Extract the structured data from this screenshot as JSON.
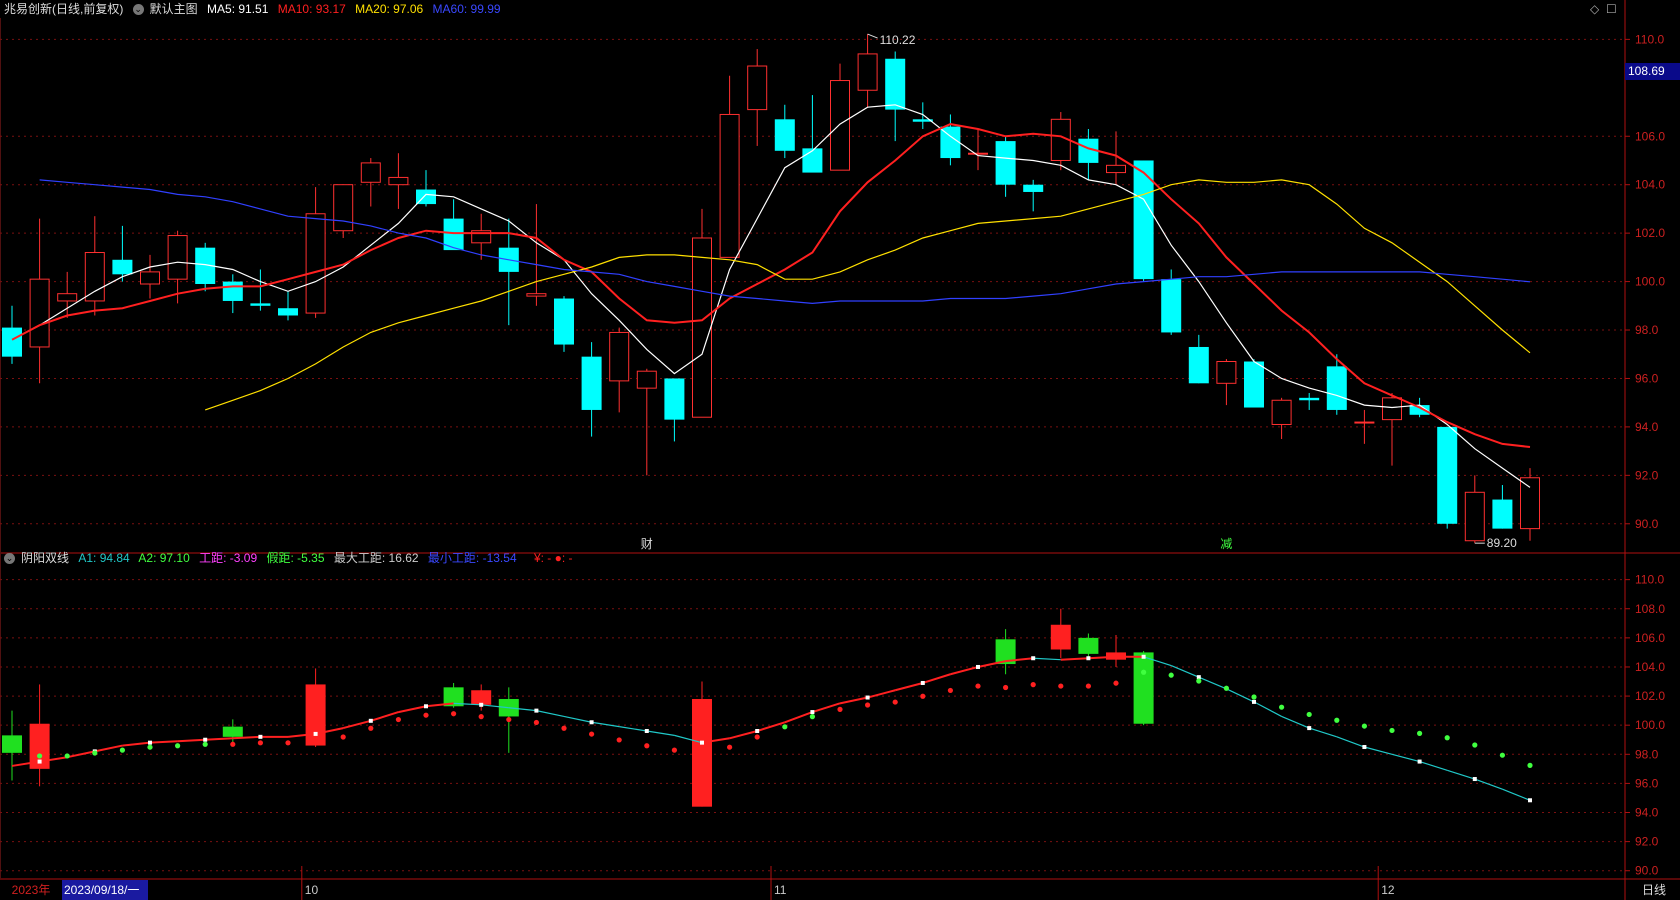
{
  "main_header": {
    "stock": "兆易创新(日线,前复权)",
    "template": "默认主图",
    "items": [
      {
        "label": "MA5: 91.51",
        "color": "#ffffff"
      },
      {
        "label": "MA10: 93.17",
        "color": "#ff2020"
      },
      {
        "label": "MA20: 97.06",
        "color": "#ffe000"
      },
      {
        "label": "MA60: 99.99",
        "color": "#3040ff"
      }
    ]
  },
  "sub_header": {
    "name": "阴阳双线",
    "items": [
      {
        "label": "A1: 94.84",
        "color": "#20c8c8"
      },
      {
        "label": "A2: 97.10",
        "color": "#40ff40"
      },
      {
        "label": "工距: -3.09",
        "color": "#ff40ff"
      },
      {
        "label": "假距: -5.35",
        "color": "#40ff40"
      },
      {
        "label": "最大工距: 16.62",
        "color": "#cccccc"
      },
      {
        "label": "最小工距: -13.54",
        "color": "#3040ff"
      },
      {
        "label": "¥: -  ●: -",
        "color": "#ff2020"
      }
    ]
  },
  "current_price": "108.69",
  "footer": {
    "year": "2023年",
    "date": "2023/09/18/一",
    "period": "日线",
    "month_labels": [
      "10",
      "11",
      "12"
    ]
  },
  "marks": {
    "cai": "财",
    "jian": "减"
  },
  "chart_data": [
    {
      "type": "candlestick",
      "title": "兆易创新(日线,前复权)",
      "ylim": [
        89,
        110.8
      ],
      "y_ticks": [
        "110.0",
        "108.69",
        "106.0",
        "104.0",
        "102.0",
        "100.0",
        "98.0",
        "96.0",
        "94.0",
        "92.0",
        "90.0"
      ],
      "annotations": [
        {
          "text": "110.22",
          "index": 31
        },
        {
          "text": "89.20",
          "index": 53
        }
      ],
      "month_starts": {
        "10": 11,
        "11": 28,
        "12": 50
      },
      "candles": [
        {
          "o": 98.1,
          "h": 99.0,
          "l": 96.6,
          "c": 96.9
        },
        {
          "o": 97.3,
          "h": 102.6,
          "l": 95.8,
          "c": 100.1
        },
        {
          "o": 99.2,
          "h": 100.4,
          "l": 98.5,
          "c": 99.5
        },
        {
          "o": 99.2,
          "h": 102.7,
          "l": 98.6,
          "c": 101.2
        },
        {
          "o": 100.9,
          "h": 102.3,
          "l": 100.0,
          "c": 100.3
        },
        {
          "o": 99.9,
          "h": 101.1,
          "l": 99.3,
          "c": 100.4
        },
        {
          "o": 100.1,
          "h": 102.1,
          "l": 99.1,
          "c": 101.9
        },
        {
          "o": 101.4,
          "h": 101.6,
          "l": 99.6,
          "c": 99.9
        },
        {
          "o": 100.0,
          "h": 100.3,
          "l": 98.7,
          "c": 99.2
        },
        {
          "o": 99.1,
          "h": 100.5,
          "l": 98.8,
          "c": 99.0
        },
        {
          "o": 98.9,
          "h": 99.6,
          "l": 98.4,
          "c": 98.6
        },
        {
          "o": 98.7,
          "h": 103.9,
          "l": 98.5,
          "c": 102.8
        },
        {
          "o": 102.1,
          "h": 104.0,
          "l": 101.8,
          "c": 104.0
        },
        {
          "o": 104.1,
          "h": 105.1,
          "l": 103.1,
          "c": 104.9
        },
        {
          "o": 104.0,
          "h": 105.3,
          "l": 103.0,
          "c": 104.3
        },
        {
          "o": 103.8,
          "h": 104.6,
          "l": 103.1,
          "c": 103.2
        },
        {
          "o": 102.6,
          "h": 103.4,
          "l": 101.4,
          "c": 101.3
        },
        {
          "o": 101.6,
          "h": 102.8,
          "l": 100.9,
          "c": 102.1
        },
        {
          "o": 101.4,
          "h": 102.6,
          "l": 98.2,
          "c": 100.4
        },
        {
          "o": 99.4,
          "h": 103.2,
          "l": 99.0,
          "c": 99.5
        },
        {
          "o": 99.3,
          "h": 99.4,
          "l": 97.1,
          "c": 97.4
        },
        {
          "o": 96.9,
          "h": 97.5,
          "l": 93.6,
          "c": 94.7
        },
        {
          "o": 95.9,
          "h": 98.1,
          "l": 94.6,
          "c": 97.9
        },
        {
          "o": 95.6,
          "h": 96.4,
          "l": 92.0,
          "c": 96.3
        },
        {
          "o": 96.0,
          "h": 96.0,
          "l": 93.4,
          "c": 94.3
        },
        {
          "o": 94.4,
          "h": 103.0,
          "l": 94.4,
          "c": 101.8
        },
        {
          "o": 101.0,
          "h": 108.5,
          "l": 101.0,
          "c": 106.9
        },
        {
          "o": 107.1,
          "h": 109.6,
          "l": 105.6,
          "c": 108.9
        },
        {
          "o": 106.7,
          "h": 107.3,
          "l": 105.1,
          "c": 105.4
        },
        {
          "o": 105.5,
          "h": 107.7,
          "l": 104.6,
          "c": 104.5
        },
        {
          "o": 104.6,
          "h": 109.0,
          "l": 104.6,
          "c": 108.3
        },
        {
          "o": 107.9,
          "h": 110.22,
          "l": 107.2,
          "c": 109.4
        },
        {
          "o": 109.2,
          "h": 109.5,
          "l": 105.8,
          "c": 107.1
        },
        {
          "o": 106.7,
          "h": 107.4,
          "l": 106.3,
          "c": 106.6
        },
        {
          "o": 106.4,
          "h": 106.9,
          "l": 104.8,
          "c": 105.1
        },
        {
          "o": 105.3,
          "h": 106.3,
          "l": 104.6,
          "c": 105.3
        },
        {
          "o": 105.8,
          "h": 106.0,
          "l": 103.5,
          "c": 104.0
        },
        {
          "o": 104.0,
          "h": 104.2,
          "l": 102.9,
          "c": 103.7
        },
        {
          "o": 105.0,
          "h": 107.0,
          "l": 104.6,
          "c": 106.7
        },
        {
          "o": 105.9,
          "h": 106.3,
          "l": 104.2,
          "c": 104.9
        },
        {
          "o": 104.5,
          "h": 106.2,
          "l": 104.0,
          "c": 104.8
        },
        {
          "o": 105.0,
          "h": 105.0,
          "l": 100.0,
          "c": 100.1
        },
        {
          "o": 100.1,
          "h": 100.5,
          "l": 97.8,
          "c": 97.9
        },
        {
          "o": 97.3,
          "h": 97.8,
          "l": 95.8,
          "c": 95.8
        },
        {
          "o": 95.8,
          "h": 96.8,
          "l": 94.9,
          "c": 96.7
        },
        {
          "o": 96.7,
          "h": 96.8,
          "l": 94.8,
          "c": 94.8
        },
        {
          "o": 94.1,
          "h": 95.2,
          "l": 93.5,
          "c": 95.1
        },
        {
          "o": 95.2,
          "h": 95.4,
          "l": 94.7,
          "c": 95.1
        },
        {
          "o": 96.5,
          "h": 97.0,
          "l": 94.5,
          "c": 94.7
        },
        {
          "o": 94.2,
          "h": 94.7,
          "l": 93.3,
          "c": 94.2
        },
        {
          "o": 94.3,
          "h": 95.4,
          "l": 92.4,
          "c": 95.2
        },
        {
          "o": 94.9,
          "h": 95.2,
          "l": 94.4,
          "c": 94.5
        },
        {
          "o": 94.0,
          "h": 94.0,
          "l": 89.8,
          "c": 90.0
        },
        {
          "o": 89.3,
          "h": 92.0,
          "l": 89.2,
          "c": 91.3
        },
        {
          "o": 91.0,
          "h": 91.6,
          "l": 89.8,
          "c": 89.8
        },
        {
          "o": 89.8,
          "h": 92.3,
          "l": 89.3,
          "c": 91.9
        }
      ],
      "series": [
        {
          "name": "MA5",
          "color": "#ffffff",
          "values": [
            97.6,
            98.2,
            98.9,
            99.6,
            100.2,
            100.6,
            100.8,
            100.7,
            100.5,
            100.0,
            99.6,
            100.0,
            100.6,
            101.5,
            102.4,
            103.6,
            103.5,
            103.0,
            102.5,
            101.6,
            100.9,
            99.5,
            98.4,
            97.2,
            96.2,
            97.0,
            100.5,
            102.6,
            104.7,
            105.4,
            106.5,
            107.2,
            107.3,
            106.9,
            106.0,
            105.2,
            105.1,
            105.0,
            104.8,
            104.2,
            104.0,
            103.4,
            101.5,
            100.0,
            98.3,
            96.7,
            96.0,
            95.6,
            95.3,
            94.9,
            94.8,
            94.9,
            94.1,
            93.1,
            92.3,
            91.5
          ]
        },
        {
          "name": "MA10",
          "color": "#ff2020",
          "values": [
            97.6,
            98.2,
            98.6,
            98.8,
            98.9,
            99.2,
            99.5,
            99.7,
            99.8,
            99.8,
            100.1,
            100.4,
            100.7,
            101.3,
            101.8,
            102.1,
            102.0,
            102.0,
            102.0,
            101.8,
            100.9,
            100.4,
            99.3,
            98.4,
            98.3,
            98.4,
            99.3,
            99.9,
            100.5,
            101.2,
            102.9,
            104.1,
            105.0,
            106.0,
            106.5,
            106.3,
            106.0,
            106.1,
            106.0,
            105.5,
            105.2,
            104.5,
            103.4,
            102.4,
            101.0,
            99.9,
            98.8,
            97.9,
            96.8,
            95.8,
            95.3,
            94.8,
            94.2,
            93.7,
            93.3,
            93.17
          ]
        },
        {
          "name": "MA20",
          "color": "#ffe000",
          "values": [
            94.7,
            95.1,
            95.5,
            96.0,
            96.6,
            97.3,
            97.9,
            98.3,
            98.6,
            98.9,
            99.2,
            99.6,
            100.0,
            100.3,
            100.6,
            101.0,
            101.1,
            101.1,
            101.0,
            100.9,
            100.7,
            100.1,
            100.1,
            100.4,
            100.9,
            101.3,
            101.8,
            102.1,
            102.4,
            102.5,
            102.6,
            102.7,
            103.0,
            103.3,
            103.6,
            104.0,
            104.2,
            104.1,
            104.1,
            104.2,
            104.0,
            103.2,
            102.2,
            101.6,
            100.8,
            100.0,
            99.0,
            98.0,
            97.06
          ]
        },
        {
          "name": "MA60",
          "color": "#3040ff",
          "values": [
            104.2,
            104.1,
            104.0,
            103.9,
            103.8,
            103.6,
            103.5,
            103.3,
            103.0,
            102.7,
            102.6,
            102.5,
            102.3,
            102.0,
            101.8,
            101.4,
            101.1,
            100.9,
            100.7,
            100.5,
            100.4,
            100.3,
            100.0,
            99.8,
            99.6,
            99.4,
            99.3,
            99.2,
            99.1,
            99.2,
            99.2,
            99.2,
            99.2,
            99.3,
            99.3,
            99.3,
            99.4,
            99.5,
            99.7,
            99.9,
            100.0,
            100.1,
            100.2,
            100.2,
            100.3,
            100.4,
            100.4,
            100.4,
            100.4,
            100.4,
            100.4,
            100.3,
            100.2,
            100.1,
            99.99
          ]
        }
      ]
    },
    {
      "type": "candlestick-indicator",
      "title": "阴阳双线",
      "ylim": [
        89.5,
        110.8
      ],
      "y_ticks": [
        "110.0",
        "108.0",
        "106.0",
        "104.0",
        "102.0",
        "100.0",
        "98.0",
        "96.0",
        "94.0",
        "92.0",
        "90.0"
      ],
      "candles": [
        {
          "i": 0,
          "o": 99.3,
          "h": 101.0,
          "l": 96.2,
          "c": 98.1
        },
        {
          "i": 1,
          "o": 97.0,
          "h": 102.8,
          "l": 95.8,
          "c": 100.1
        },
        {
          "i": 8,
          "o": 99.9,
          "h": 100.4,
          "l": 98.8,
          "c": 99.2
        },
        {
          "i": 11,
          "o": 98.6,
          "h": 103.9,
          "l": 98.5,
          "c": 102.8
        },
        {
          "i": 16,
          "o": 102.6,
          "h": 102.9,
          "l": 101.2,
          "c": 101.3
        },
        {
          "i": 17,
          "o": 101.4,
          "h": 102.8,
          "l": 101.0,
          "c": 102.4
        },
        {
          "i": 18,
          "o": 101.8,
          "h": 102.6,
          "l": 98.1,
          "c": 100.6
        },
        {
          "i": 25,
          "o": 94.4,
          "h": 103.0,
          "l": 94.4,
          "c": 101.8
        },
        {
          "i": 36,
          "o": 105.9,
          "h": 106.6,
          "l": 103.5,
          "c": 104.2
        },
        {
          "i": 38,
          "o": 105.2,
          "h": 108.0,
          "l": 104.6,
          "c": 106.9
        },
        {
          "i": 39,
          "o": 106.0,
          "h": 106.3,
          "l": 104.6,
          "c": 104.9
        },
        {
          "i": 40,
          "o": 104.5,
          "h": 106.2,
          "l": 104.0,
          "c": 105.0
        },
        {
          "i": 41,
          "o": 105.0,
          "h": 105.1,
          "l": 100.0,
          "c": 100.1
        }
      ],
      "line": [
        97.2,
        97.5,
        97.8,
        98.2,
        98.6,
        98.8,
        98.9,
        99.0,
        99.1,
        99.2,
        99.2,
        99.4,
        99.8,
        100.3,
        100.9,
        101.3,
        101.5,
        101.4,
        101.2,
        101.0,
        100.6,
        100.2,
        99.9,
        99.6,
        99.3,
        98.8,
        99.1,
        99.6,
        100.2,
        100.9,
        101.5,
        101.9,
        102.4,
        102.9,
        103.5,
        104.0,
        104.4,
        104.6,
        104.5,
        104.6,
        104.7,
        104.7,
        104.1,
        103.3,
        102.5,
        101.6,
        100.6,
        99.8,
        99.2,
        98.5,
        98.0,
        97.5,
        96.9,
        96.3,
        95.6,
        94.84
      ],
      "dots": [
        null,
        98.3,
        98.3,
        98.5,
        98.7,
        98.9,
        99.0,
        99.1,
        99.1,
        99.2,
        99.2,
        99.3,
        99.6,
        100.2,
        100.8,
        101.1,
        101.2,
        101.0,
        100.8,
        100.6,
        100.2,
        99.8,
        99.4,
        99.0,
        98.7,
        98.5,
        98.9,
        99.6,
        100.3,
        101.0,
        101.5,
        101.8,
        102.0,
        102.4,
        102.8,
        103.1,
        103.0,
        103.2,
        103.1,
        103.1,
        103.3,
        103.5,
        103.3,
        102.9,
        102.4,
        101.8,
        101.1,
        100.6,
        100.2,
        99.8,
        99.5,
        99.3,
        99.0,
        98.5,
        97.8,
        97.1
      ]
    }
  ]
}
